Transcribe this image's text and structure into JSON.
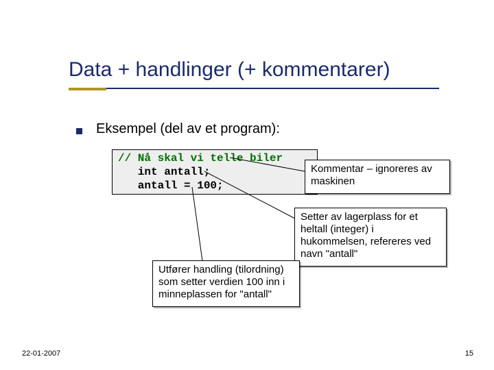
{
  "title": "Data + handlinger (+ kommentarer)",
  "bullet": "Eksempel (del av et program):",
  "code": {
    "line1": "// Nå skal vi telle biler",
    "line2": "   int antall;",
    "line3": "   antall = 100;"
  },
  "annotations": {
    "comment": "Kommentar – ignoreres av maskinen",
    "storage": "Setter av lagerplass for et heltall (integer) i hukommelsen, refereres ved navn \"antall\"",
    "assign": "Utfører handling (tilordning) som setter verdien 100 inn i minneplassen for \"antall\""
  },
  "footer": {
    "date": "22-01-2007",
    "page": "15"
  }
}
